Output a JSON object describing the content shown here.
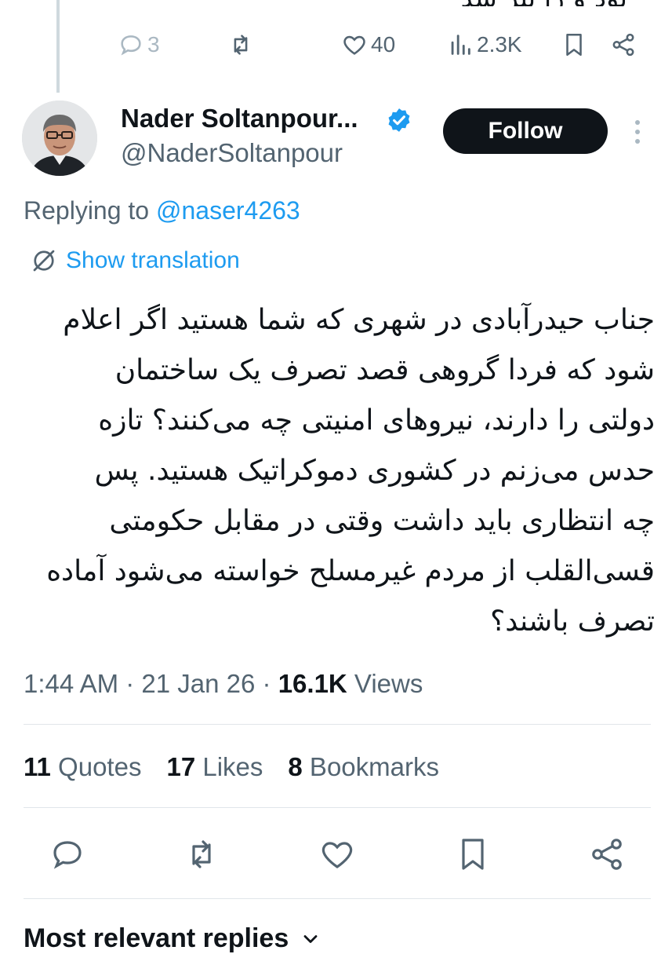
{
  "previous_tweet": {
    "text_fragment": "بود و را پیر شد",
    "actions": {
      "replies": "3",
      "retweets": "",
      "likes": "40",
      "views": "2.3K"
    }
  },
  "author": {
    "name": "Nader Soltanpour...",
    "handle": "@NaderSoltanpour",
    "verified_icon": "verified-badge-icon",
    "follow_label": "Follow"
  },
  "reply": {
    "prefix": "Replying to ",
    "mention": "@naser4263"
  },
  "translation": {
    "label": "Show translation"
  },
  "tweet": {
    "lines": [
      "جناب حیدرآبادی در شهری که شما هستید اگر اعلام",
      "شود که فردا گروهی قصد تصرف یک ساختمان",
      "دولتی را دارند، نیروهای امنیتی چه می‌کنند؟ تازه",
      "حدس می‌زنم در کشوری دموکراتیک هستید. پس",
      "چه انتظاری باید داشت وقتی در مقابل حکومتی",
      "قسی‌القلب از مردم غیرمسلح خواسته می‌شود آماده",
      "تصرف باشند؟"
    ]
  },
  "meta": {
    "time": "1:44 AM",
    "sep1": " · ",
    "date": "21 Jan 26",
    "sep2": " · ",
    "views_count": "16.1K",
    "views_label": " Views"
  },
  "stats": {
    "quotes_count": "11",
    "quotes_label": " Quotes",
    "likes_count": "17",
    "likes_label": " Likes",
    "bookmarks_count": "8",
    "bookmarks_label": " Bookmarks"
  },
  "section": {
    "title": "Most relevant replies"
  },
  "colors": {
    "accent": "#1d9bf0",
    "text": "#0f1419",
    "muted": "#536471",
    "follow_bg": "#0f1419"
  }
}
